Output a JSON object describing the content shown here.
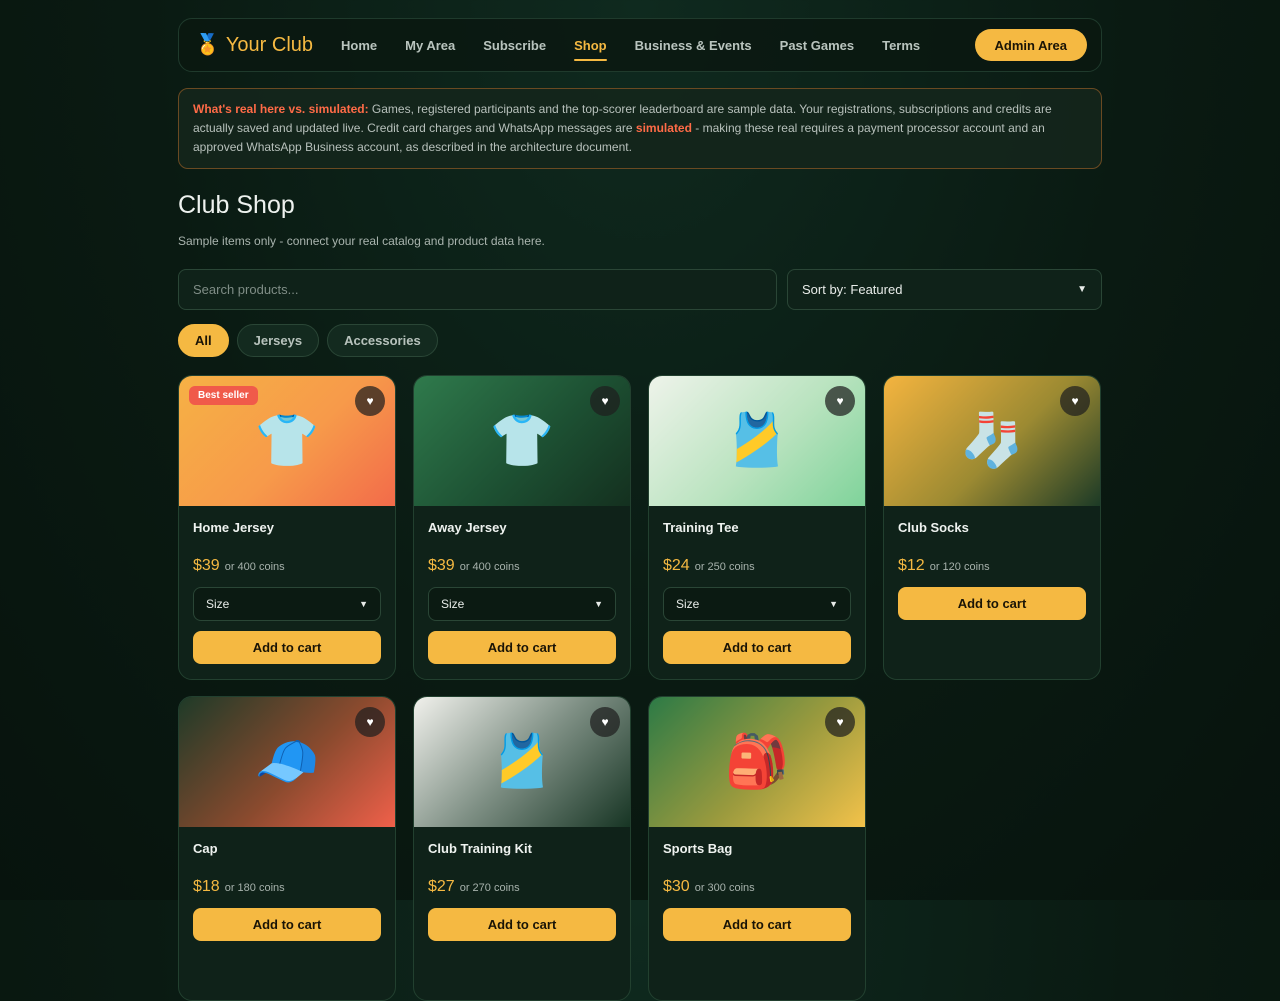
{
  "header": {
    "brand_icon": "🏅",
    "brand": "Your Club",
    "nav": [
      {
        "label": "Home",
        "active": false
      },
      {
        "label": "My Area",
        "active": false
      },
      {
        "label": "Subscribe",
        "active": false
      },
      {
        "label": "Shop",
        "active": true
      },
      {
        "label": "Business & Events",
        "active": false
      },
      {
        "label": "Past Games",
        "active": false
      },
      {
        "label": "Terms",
        "active": false
      }
    ],
    "admin_button": "Admin Area"
  },
  "notice": {
    "lead": "What's real here vs. simulated:",
    "text1": " Games, registered participants and the top-scorer leaderboard are sample data. Your registrations, subscriptions and credits are actually saved and updated live. Credit card charges and WhatsApp messages are ",
    "highlight": "simulated",
    "text2": " - making these real requires a payment processor account and an approved WhatsApp Business account, as described in the architecture document."
  },
  "page": {
    "title": "Club Shop",
    "subtitle": "Sample items only - connect your real catalog and product data here."
  },
  "search": {
    "placeholder": "Search products..."
  },
  "sort": {
    "value": "Sort by: Featured"
  },
  "filters": [
    {
      "label": "All",
      "active": true
    },
    {
      "label": "Jerseys",
      "active": false
    },
    {
      "label": "Accessories",
      "active": false
    }
  ],
  "products": [
    {
      "name": "Home Jersey",
      "price": "$39",
      "coins": "or 400 coins",
      "emoji": "👕",
      "badge": "Best seller",
      "size_label": "Size",
      "has_size": true,
      "add_label": "Add to cart",
      "bg": "linear-gradient(135deg,#f6b145 0%,#f79a4a 55%,#f26b4a 100%)"
    },
    {
      "name": "Away Jersey",
      "price": "$39",
      "coins": "or 400 coins",
      "emoji": "👕",
      "badge": "",
      "size_label": "Size",
      "has_size": true,
      "add_label": "Add to cart",
      "bg": "linear-gradient(135deg,#2f7a4c 0%,#1d5133 55%,#14301f 100%)"
    },
    {
      "name": "Training Tee",
      "price": "$24",
      "coins": "or 250 coins",
      "emoji": "🎽",
      "badge": "",
      "size_label": "Size",
      "has_size": true,
      "add_label": "Add to cart",
      "bg": "linear-gradient(135deg,#eef3ea 0%,#b9e3bf 55%,#7fd39a 100%)"
    },
    {
      "name": "Club Socks",
      "price": "$12",
      "coins": "or 120 coins",
      "emoji": "🧦",
      "badge": "",
      "size_label": "",
      "has_size": false,
      "add_label": "Add to cart",
      "bg": "linear-gradient(135deg,#f4b43f 0%,#9c8a32 55%,#1c3a26 100%)"
    },
    {
      "name": "Cap",
      "price": "$18",
      "coins": "or 180 coins",
      "emoji": "🧢",
      "badge": "",
      "size_label": "",
      "has_size": false,
      "add_label": "Add to cart",
      "bg": "linear-gradient(135deg,#1e3a28 0%,#8a4a2e 55%,#f0604a 100%)"
    },
    {
      "name": "Club Training Kit",
      "price": "$27",
      "coins": "or 270 coins",
      "emoji": "🎽",
      "badge": "",
      "size_label": "",
      "has_size": false,
      "add_label": "Add to cart",
      "bg": "linear-gradient(135deg,#f1f1ec 0%,#7e8f84 50%,#173524 100%)"
    },
    {
      "name": "Sports Bag",
      "price": "$30",
      "coins": "or 300 coins",
      "emoji": "🎒",
      "badge": "",
      "size_label": "",
      "has_size": false,
      "add_label": "Add to cart",
      "bg": "linear-gradient(135deg,#2c7a46 0%,#9a9a3e 55%,#f3c24a 100%)"
    }
  ],
  "fav_icon": "♥"
}
